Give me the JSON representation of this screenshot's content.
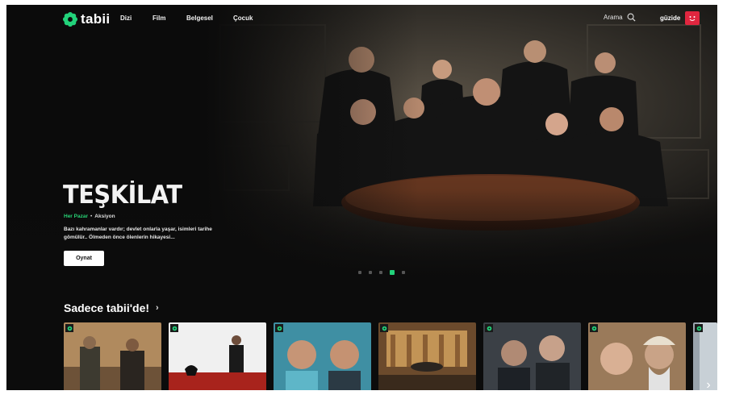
{
  "brand": {
    "name": "tabii",
    "accent": "#22d27a"
  },
  "nav": {
    "links": [
      "Dizi",
      "Film",
      "Belgesel",
      "Çocuk"
    ],
    "search_label": "Arama",
    "profile_name": "güzide"
  },
  "hero": {
    "title": "TEŞKİLAT",
    "schedule": "Her Pazar",
    "genre": "Aksiyon",
    "description": "Bazı kahramanlar vardır; devlet onlarla yaşar, isimleri tarihe gömülür.. Ölmeden önce ölenlerin hikayesi...",
    "play_label": "Oynat",
    "slides_total": 5,
    "active_slide": 4
  },
  "section": {
    "title": "Sadece tabii'de!",
    "cards": [
      {
        "name": "card-1"
      },
      {
        "name": "card-2"
      },
      {
        "name": "card-3"
      },
      {
        "name": "card-4"
      },
      {
        "name": "card-5"
      },
      {
        "name": "card-6"
      },
      {
        "name": "card-7"
      }
    ]
  },
  "icons": [
    "tabii-logo-icon",
    "search-icon",
    "avatar-icon",
    "chevron-right-icon",
    "tabii-badge-icon",
    "next-arrow-icon"
  ]
}
